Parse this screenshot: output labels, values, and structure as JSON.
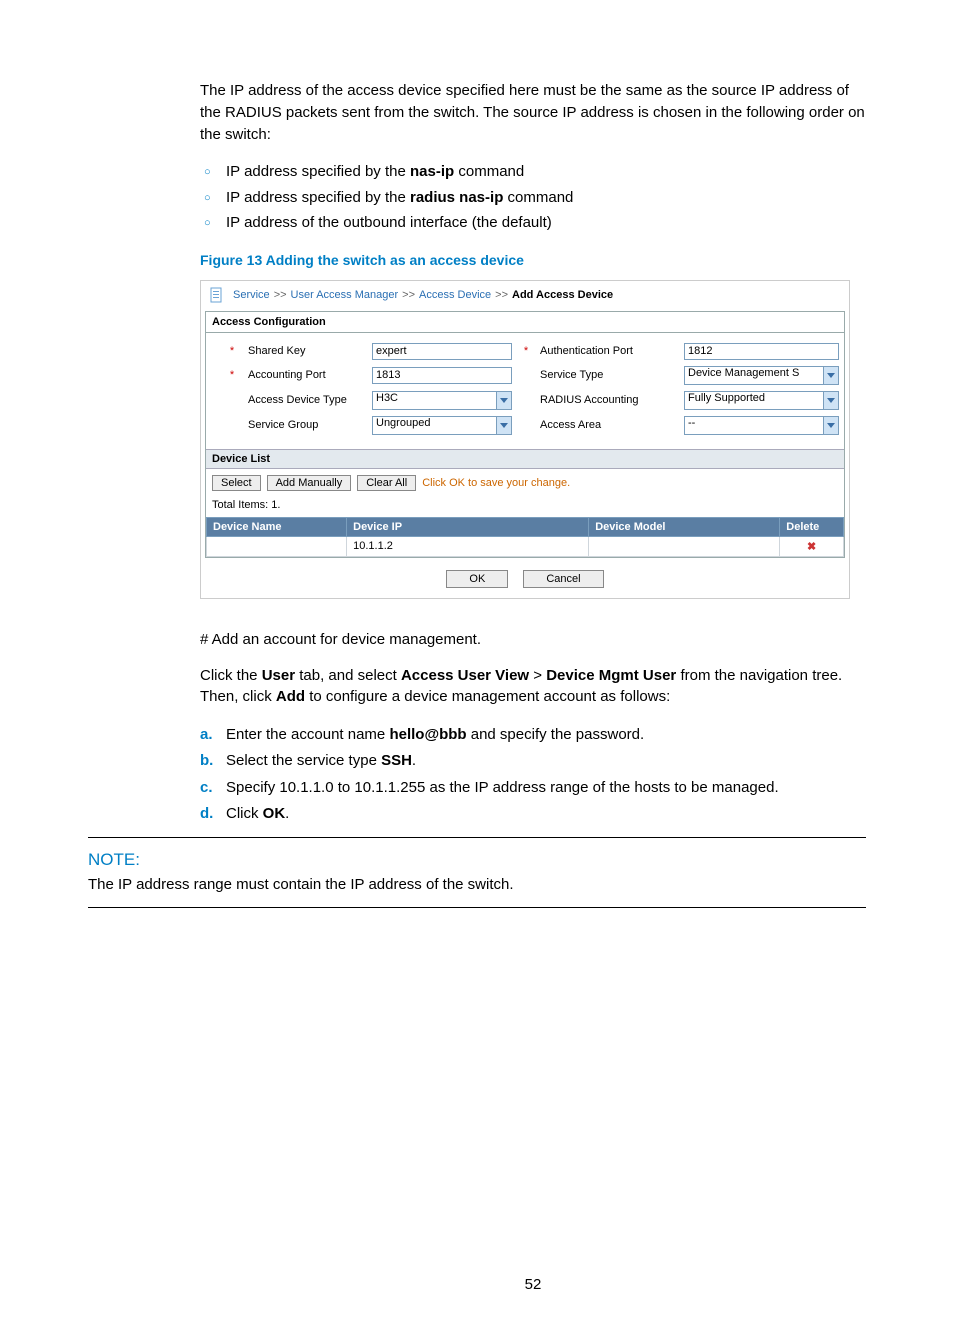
{
  "intro_paragraph": "The IP address of the access device specified here must be the same as the source IP address of the RADIUS packets sent from the switch. The source IP address is chosen in the following order on the switch:",
  "ip_order": [
    {
      "pre": "IP address specified by the ",
      "bold": "nas-ip",
      "post": " command"
    },
    {
      "pre": "IP address specified by the ",
      "bold": "radius nas-ip",
      "post": " command"
    },
    {
      "pre": "IP address of the outbound interface (the default)",
      "bold": "",
      "post": ""
    }
  ],
  "figure_caption": "Figure 13 Adding the switch as an access device",
  "figure": {
    "breadcrumb": {
      "service": "Service",
      "uam": "User Access Manager",
      "ad": "Access Device",
      "current": "Add Access Device",
      "sep": ">>"
    },
    "panel_title": "Access Configuration",
    "fields": {
      "shared_key_label": "Shared Key",
      "shared_key_value": "expert",
      "auth_port_label": "Authentication Port",
      "auth_port_value": "1812",
      "acct_port_label": "Accounting Port",
      "acct_port_value": "1813",
      "service_type_label": "Service Type",
      "service_type_value": "Device Management S",
      "access_dev_type_label": "Access Device Type",
      "access_dev_type_value": "H3C",
      "radius_acct_label": "RADIUS Accounting",
      "radius_acct_value": "Fully Supported",
      "service_group_label": "Service Group",
      "service_group_value": "Ungrouped",
      "access_area_label": "Access Area",
      "access_area_value": "--"
    },
    "device_list_title": "Device List",
    "buttons": {
      "select": "Select",
      "add_manually": "Add Manually",
      "clear_all": "Clear All"
    },
    "hint": "Click OK to save your change.",
    "total_items": "Total Items: 1.",
    "table": {
      "h_name": "Device Name",
      "h_ip": "Device IP",
      "h_model": "Device Model",
      "h_delete": "Delete",
      "row_ip": "10.1.1.2"
    },
    "ok": "OK",
    "cancel": "Cancel"
  },
  "add_account_line": "# Add an account for device management.",
  "click_user_parts": {
    "a": "Click the ",
    "b": "User",
    "c": " tab, and select ",
    "d": "Access User View",
    "e": " > ",
    "f": "Device Mgmt User",
    "g": " from the navigation tree. Then, click ",
    "h": "Add",
    "i": " to configure a device management account as follows:"
  },
  "steps": [
    {
      "mk": "a.",
      "parts": [
        "Enter the account name ",
        "hello@bbb",
        " and specify the password."
      ]
    },
    {
      "mk": "b.",
      "parts": [
        "Select the service type ",
        "SSH",
        "."
      ]
    },
    {
      "mk": "c.",
      "parts": [
        "Specify 10.1.1.0 to 10.1.1.255 as the IP address range of the hosts to be managed.",
        "",
        ""
      ]
    },
    {
      "mk": "d.",
      "parts": [
        "Click ",
        "OK",
        "."
      ]
    }
  ],
  "note_title": "NOTE:",
  "note_body": "The IP address range must contain the IP address of the switch.",
  "page_number": "52"
}
